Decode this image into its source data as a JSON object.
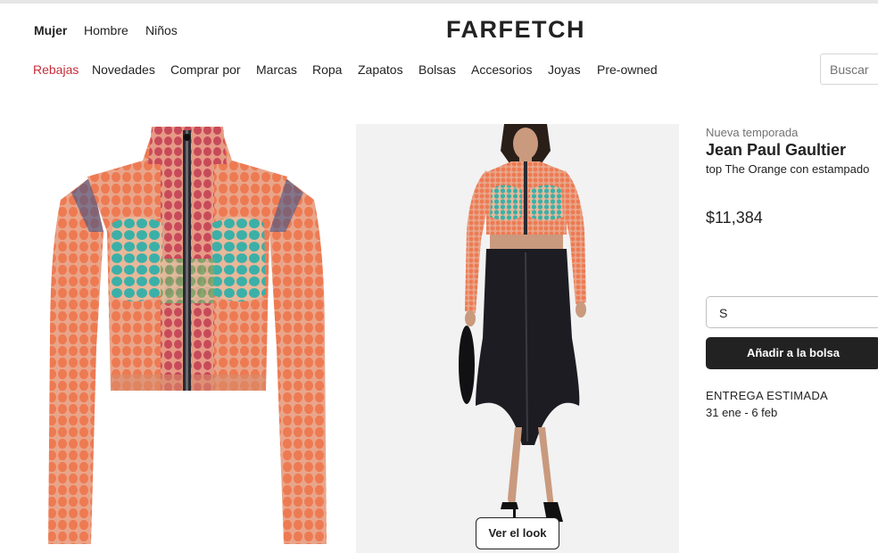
{
  "header": {
    "genders": [
      "Mujer",
      "Hombre",
      "Niños"
    ],
    "logo": "FARFETCH"
  },
  "nav": {
    "items": [
      "Rebajas",
      "Novedades",
      "Comprar por",
      "Marcas",
      "Ropa",
      "Zapatos",
      "Bolsas",
      "Accesorios",
      "Joyas",
      "Pre-owned"
    ]
  },
  "search": {
    "placeholder": "Buscar"
  },
  "gallery": {
    "look_button": "Ver el look"
  },
  "product": {
    "season": "Nueva temporada",
    "brand": "Jean Paul Gaultier",
    "name": "top The Orange con estampado",
    "price": "$11,384",
    "size_selected": "S",
    "add_to_bag": "Añadir a la bolsa",
    "delivery_label": "ENTREGA ESTIMADA",
    "delivery_dates": "31 ene - 6 feb"
  },
  "colors": {
    "sale": "#c62d3a",
    "button": "#222222",
    "top_orange": "#ee7a52",
    "top_teal": "#3bb0a8",
    "top_red": "#c84a5a",
    "top_green": "#78a86a",
    "skirt": "#1c1c22"
  }
}
